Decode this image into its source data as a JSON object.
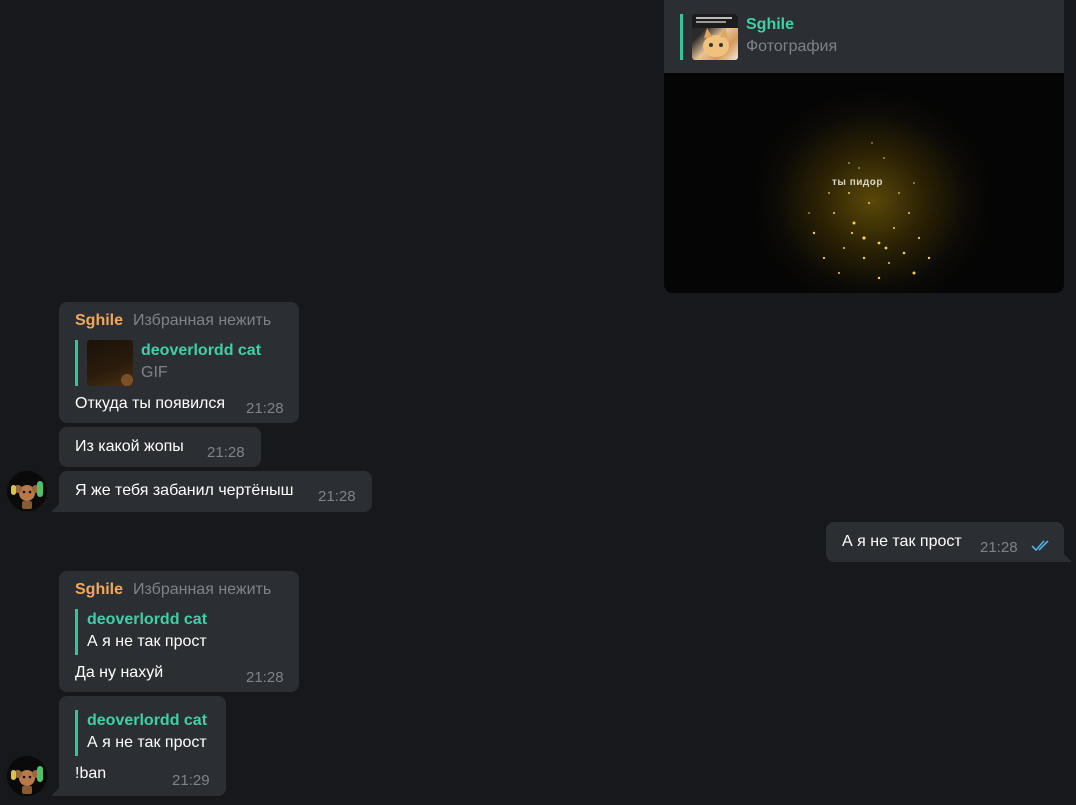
{
  "colors": {
    "background": "#17181c",
    "bubble": "#2b2e33",
    "reply_accent": "#35c4a0",
    "sender_name": "#f0a85a",
    "muted": "#7f8389",
    "check": "#4fb2e6"
  },
  "messages": {
    "m1": {
      "reply": {
        "name": "Sghile",
        "sub": "Фотография"
      },
      "photo_text": "ты пидор"
    },
    "m2": {
      "sender": "Sghile",
      "title": "Избранная нежить",
      "reply": {
        "name": "deoverlordd cat",
        "sub": "GIF"
      },
      "text": "Откуда ты появился",
      "time": "21:28"
    },
    "m3": {
      "text": "Из какой жопы",
      "time": "21:28"
    },
    "m4": {
      "text": "Я же тебя забанил чертёныш",
      "time": "21:28"
    },
    "m5": {
      "text": "А я не так прост",
      "time": "21:28",
      "status_icon": "double-check-icon"
    },
    "m6": {
      "sender": "Sghile",
      "title": "Избранная нежить",
      "reply": {
        "name": "deoverlordd cat",
        "text": "А я не так прост"
      },
      "text": "Да ну нахуй",
      "time": "21:28"
    },
    "m7": {
      "reply": {
        "name": "deoverlordd cat",
        "text": "А я не так прост"
      },
      "text": "!ban",
      "time": "21:29"
    }
  }
}
